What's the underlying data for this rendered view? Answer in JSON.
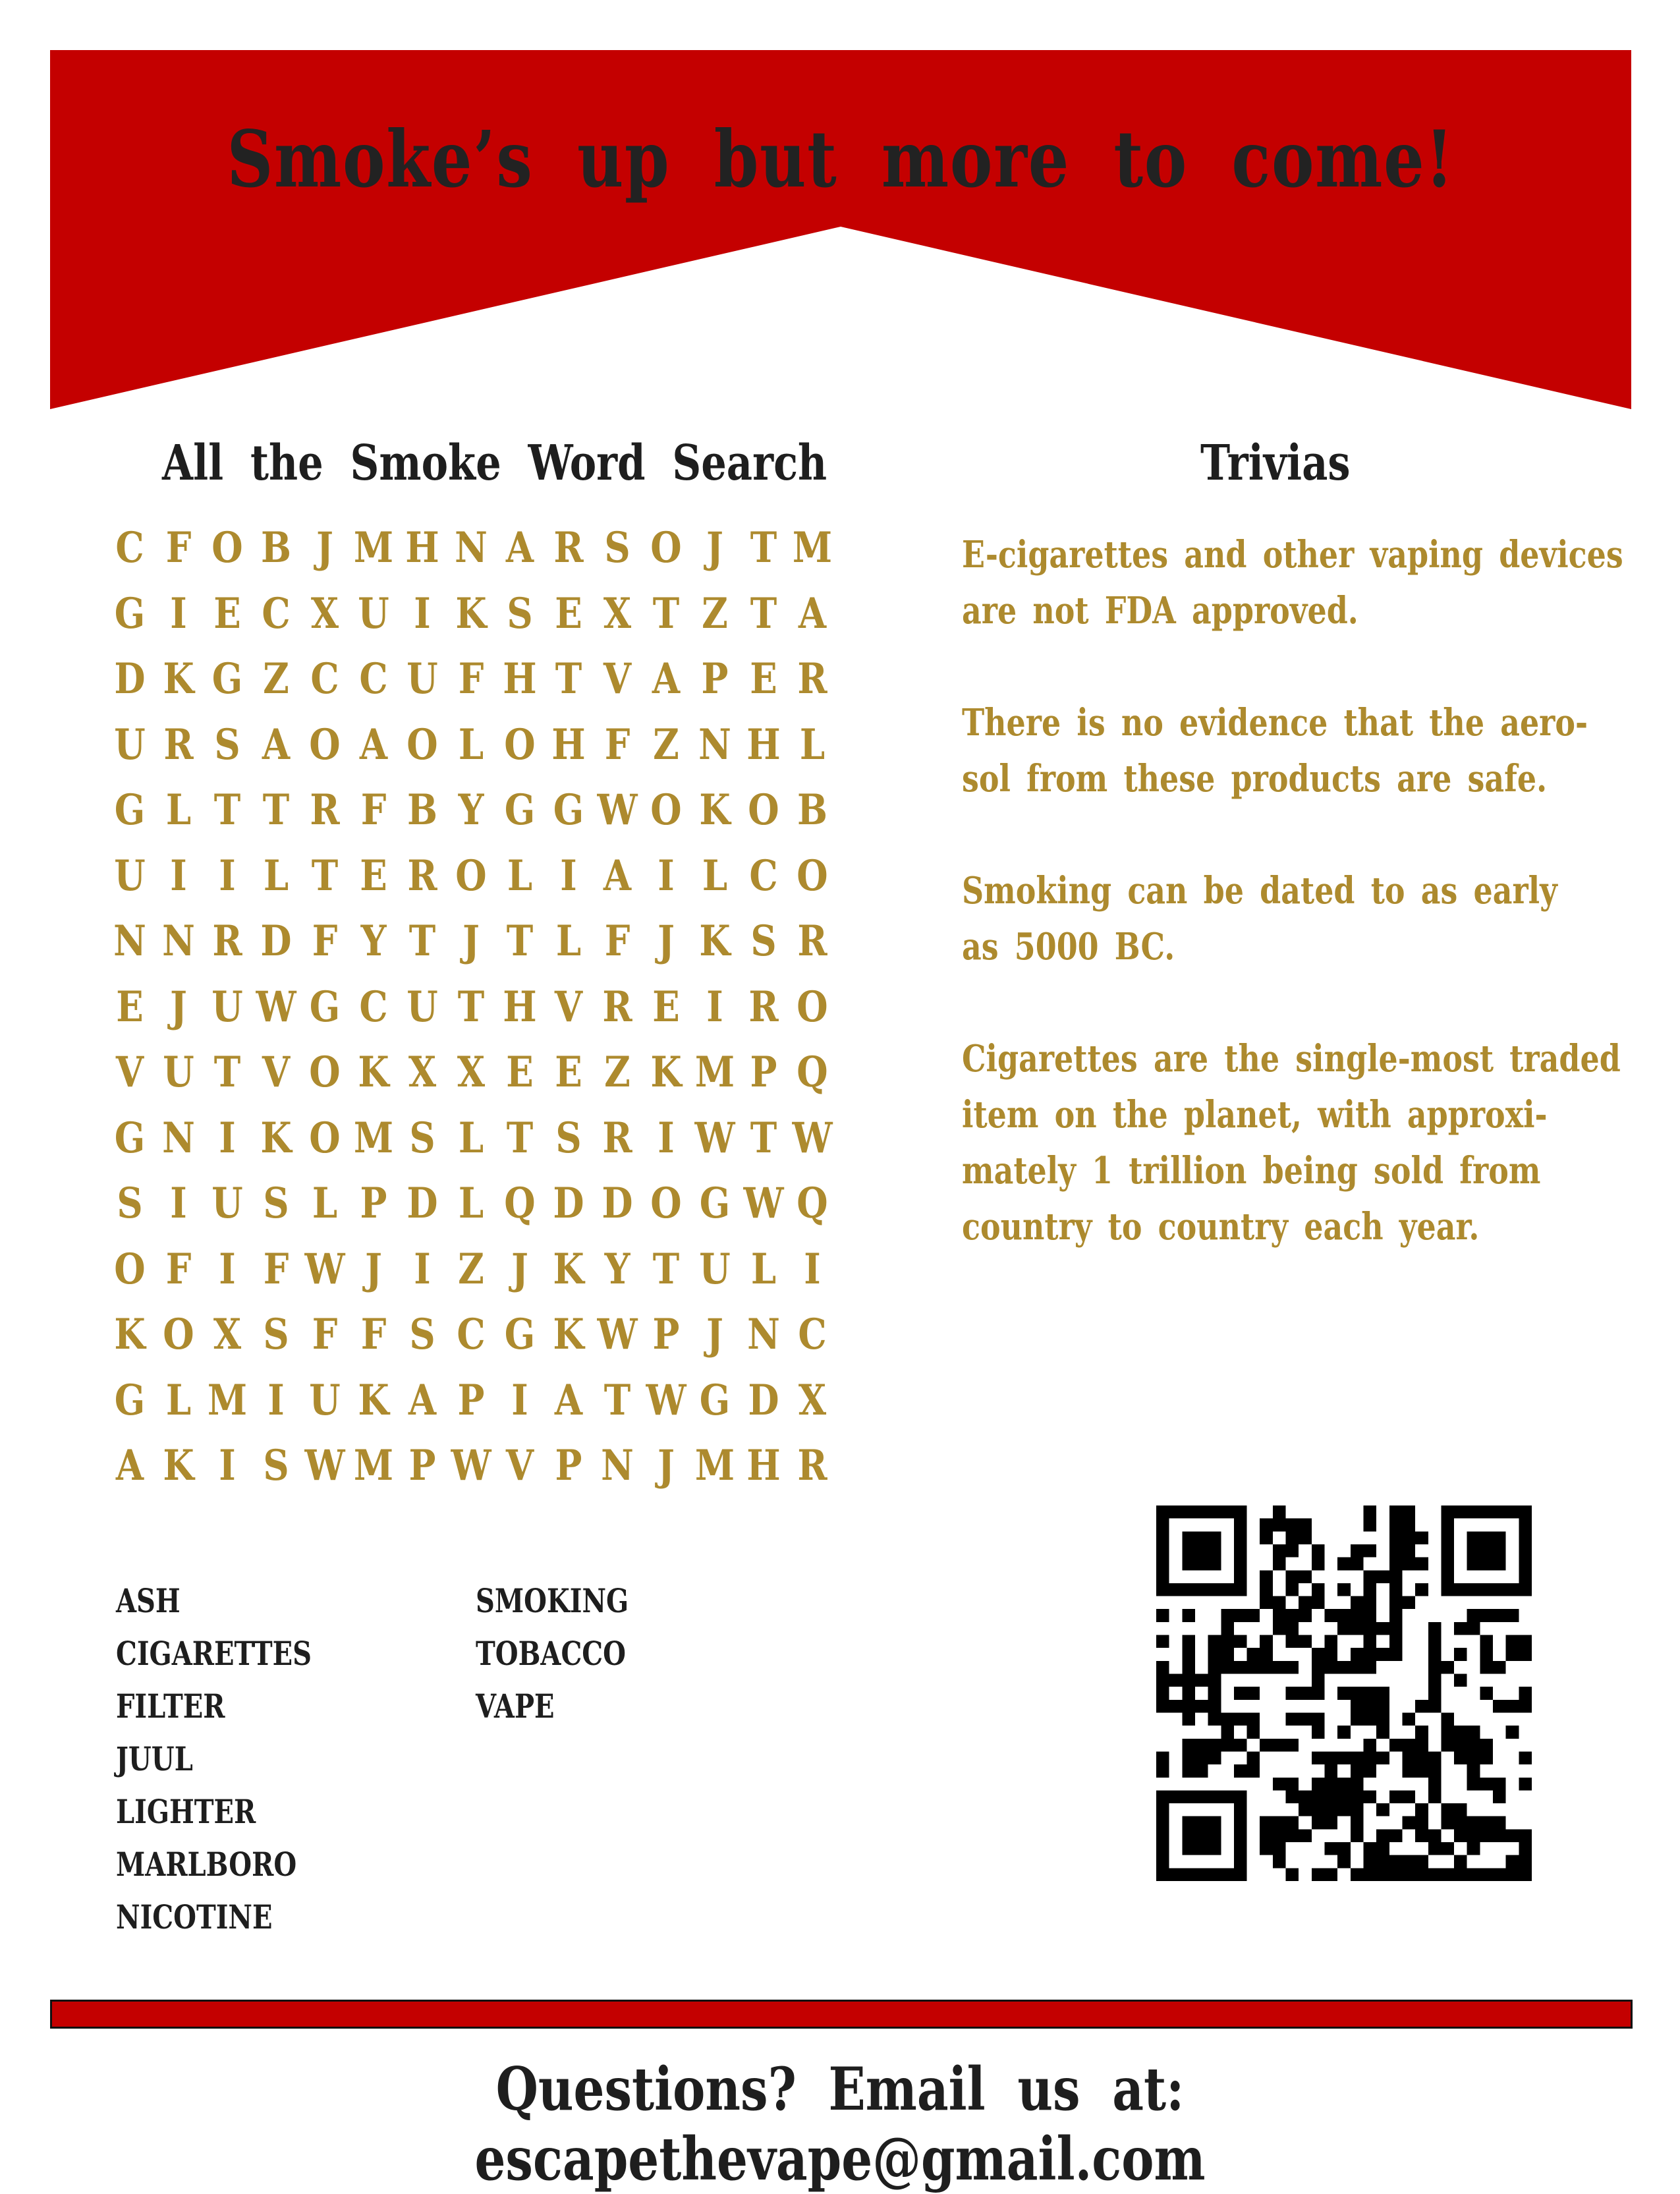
{
  "header": {
    "title": "Smoke’s up but more to come!",
    "banner_color": "#c40000"
  },
  "word_search": {
    "title": "All the Smoke Word Search",
    "grid": [
      [
        "C",
        "F",
        "O",
        "B",
        "J",
        "M",
        "H",
        "N",
        "A",
        "R",
        "S",
        "O",
        "J",
        "T",
        "M"
      ],
      [
        "G",
        "I",
        "E",
        "C",
        "X",
        "U",
        "I",
        "K",
        "S",
        "E",
        "X",
        "T",
        "Z",
        "T",
        "A"
      ],
      [
        "D",
        "K",
        "G",
        "Z",
        "C",
        "C",
        "U",
        "F",
        "H",
        "T",
        "V",
        "A",
        "P",
        "E",
        "R"
      ],
      [
        "U",
        "R",
        "S",
        "A",
        "O",
        "A",
        "O",
        "L",
        "O",
        "H",
        "F",
        "Z",
        "N",
        "H",
        "L"
      ],
      [
        "G",
        "L",
        "T",
        "T",
        "R",
        "F",
        "B",
        "Y",
        "G",
        "G",
        "W",
        "O",
        "K",
        "O",
        "B"
      ],
      [
        "U",
        "I",
        "I",
        "L",
        "T",
        "E",
        "R",
        "O",
        "L",
        "I",
        "A",
        "I",
        "L",
        "C",
        "O"
      ],
      [
        "N",
        "N",
        "R",
        "D",
        "F",
        "Y",
        "T",
        "J",
        "T",
        "L",
        "F",
        "J",
        "K",
        "S",
        "R"
      ],
      [
        "E",
        "J",
        "U",
        "W",
        "G",
        "C",
        "U",
        "T",
        "H",
        "V",
        "R",
        "E",
        "I",
        "R",
        "O"
      ],
      [
        "V",
        "U",
        "T",
        "V",
        "O",
        "K",
        "X",
        "X",
        "E",
        "E",
        "Z",
        "K",
        "M",
        "P",
        "Q"
      ],
      [
        "G",
        "N",
        "I",
        "K",
        "O",
        "M",
        "S",
        "L",
        "T",
        "S",
        "R",
        "I",
        "W",
        "T",
        "W"
      ],
      [
        "S",
        "I",
        "U",
        "S",
        "L",
        "P",
        "D",
        "L",
        "Q",
        "D",
        "D",
        "O",
        "G",
        "W",
        "Q"
      ],
      [
        "O",
        "F",
        "I",
        "F",
        "W",
        "J",
        "I",
        "Z",
        "J",
        "K",
        "Y",
        "T",
        "U",
        "L",
        "I"
      ],
      [
        "K",
        "O",
        "X",
        "S",
        "F",
        "F",
        "S",
        "C",
        "G",
        "K",
        "W",
        "P",
        "J",
        "N",
        "C"
      ],
      [
        "G",
        "L",
        "M",
        "I",
        "U",
        "K",
        "A",
        "P",
        "I",
        "A",
        "T",
        "W",
        "G",
        "D",
        "X"
      ],
      [
        "A",
        "K",
        "I",
        "S",
        "W",
        "M",
        "P",
        "W",
        "V",
        "P",
        "N",
        "J",
        "M",
        "H",
        "R"
      ]
    ],
    "words_col1": [
      "ASH",
      "CIGARETTES",
      "FILTER",
      "JUUL",
      "LIGHTER",
      "MARLBORO",
      "NICOTINE"
    ],
    "words_col2": [
      "SMOKING",
      "TOBACCO",
      "VAPE"
    ],
    "letter_color": "#ad8a2e"
  },
  "trivia": {
    "title": "Trivias",
    "items": [
      "E-cigarettes and other vaping devices\nare not FDA approved.",
      "There is no evidence that the aero-\nsol from these products are safe.",
      "Smoking can be dated to as early\nas 5000 BC.",
      "Cigarettes are the single-most traded\nitem on the planet, with approxi-\nmately 1 trillion being sold from\ncountry to country each year."
    ]
  },
  "qr_code": {
    "icon": "qr-code"
  },
  "footer": {
    "text": "Questions? Email us at: escapethevape@gmail.com"
  }
}
